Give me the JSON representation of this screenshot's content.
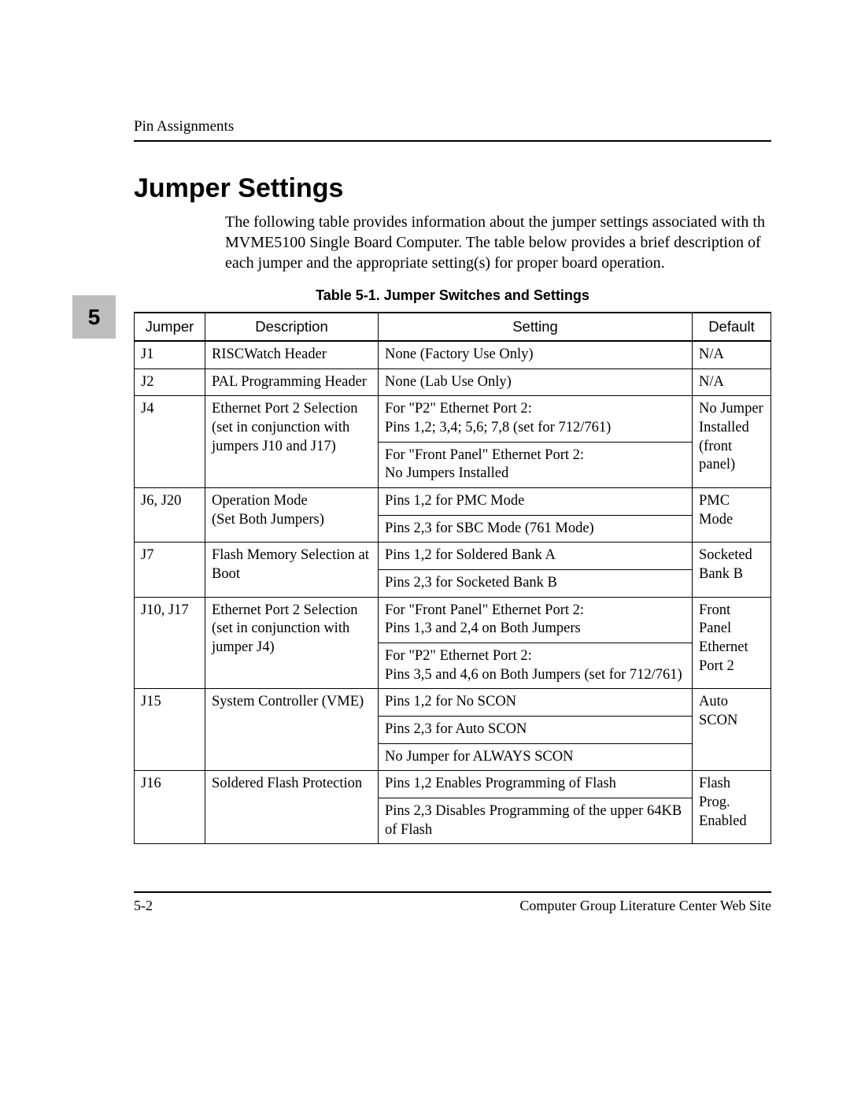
{
  "header": {
    "running_head": "Pin Assignments"
  },
  "chapter_tab": "5",
  "section": {
    "title": "Jumper Settings",
    "intro": "The following table provides information about the jumper settings associated with th MVME5100 Single Board Computer. The table below provides a brief description of each jumper and the appropriate setting(s) for proper board operation."
  },
  "table": {
    "caption": "Table 5-1.  Jumper Switches and Settings",
    "columns": [
      "Jumper",
      "Description",
      "Setting",
      "Default"
    ],
    "rows": [
      {
        "jumper": "J1",
        "description": "RISCWatch Header",
        "settings": [
          "None (Factory Use Only)"
        ],
        "default": "N/A"
      },
      {
        "jumper": "J2",
        "description": "PAL Programming Header",
        "settings": [
          "None (Lab Use Only)"
        ],
        "default": "N/A"
      },
      {
        "jumper": "J4",
        "description": "Ethernet Port 2 Selection (set in conjunction with jumpers J10 and J17)",
        "settings": [
          "For \"P2\" Ethernet Port 2:\nPins 1,2; 3,4; 5,6; 7,8 (set for 712/761)",
          "For \"Front Panel\" Ethernet Port 2:\nNo Jumpers Installed"
        ],
        "default": "No Jumper Installed (front panel)"
      },
      {
        "jumper": "J6, J20",
        "description": "Operation Mode\n(Set Both Jumpers)",
        "settings": [
          "Pins 1,2 for PMC Mode",
          "Pins 2,3 for SBC Mode (761 Mode)"
        ],
        "default": "PMC Mode"
      },
      {
        "jumper": "J7",
        "description": "Flash Memory Selection at Boot",
        "settings": [
          "Pins 1,2 for Soldered Bank A",
          "Pins 2,3 for Socketed Bank B"
        ],
        "default": "Socketed Bank B"
      },
      {
        "jumper": "J10, J17",
        "description": "Ethernet Port 2 Selection (set in conjunction with jumper J4)",
        "settings": [
          "For \"Front Panel\" Ethernet Port 2:\nPins 1,3 and 2,4 on Both Jumpers",
          "For \"P2\" Ethernet Port 2:\nPins 3,5 and 4,6 on Both Jumpers (set for 712/761)"
        ],
        "default": "Front Panel Ethernet Port 2"
      },
      {
        "jumper": "J15",
        "description": "System Controller (VME)",
        "settings": [
          "Pins 1,2 for No SCON",
          "Pins 2,3 for Auto SCON",
          "No Jumper for ALWAYS SCON"
        ],
        "default": "Auto SCON"
      },
      {
        "jumper": "J16",
        "description": "Soldered Flash Protection",
        "settings": [
          "Pins 1,2 Enables Programming of Flash",
          "Pins 2,3 Disables Programming  of the upper 64KB of Flash"
        ],
        "default": "Flash Prog. Enabled"
      }
    ]
  },
  "footer": {
    "left": "5-2",
    "right": "Computer Group Literature Center Web Site"
  }
}
